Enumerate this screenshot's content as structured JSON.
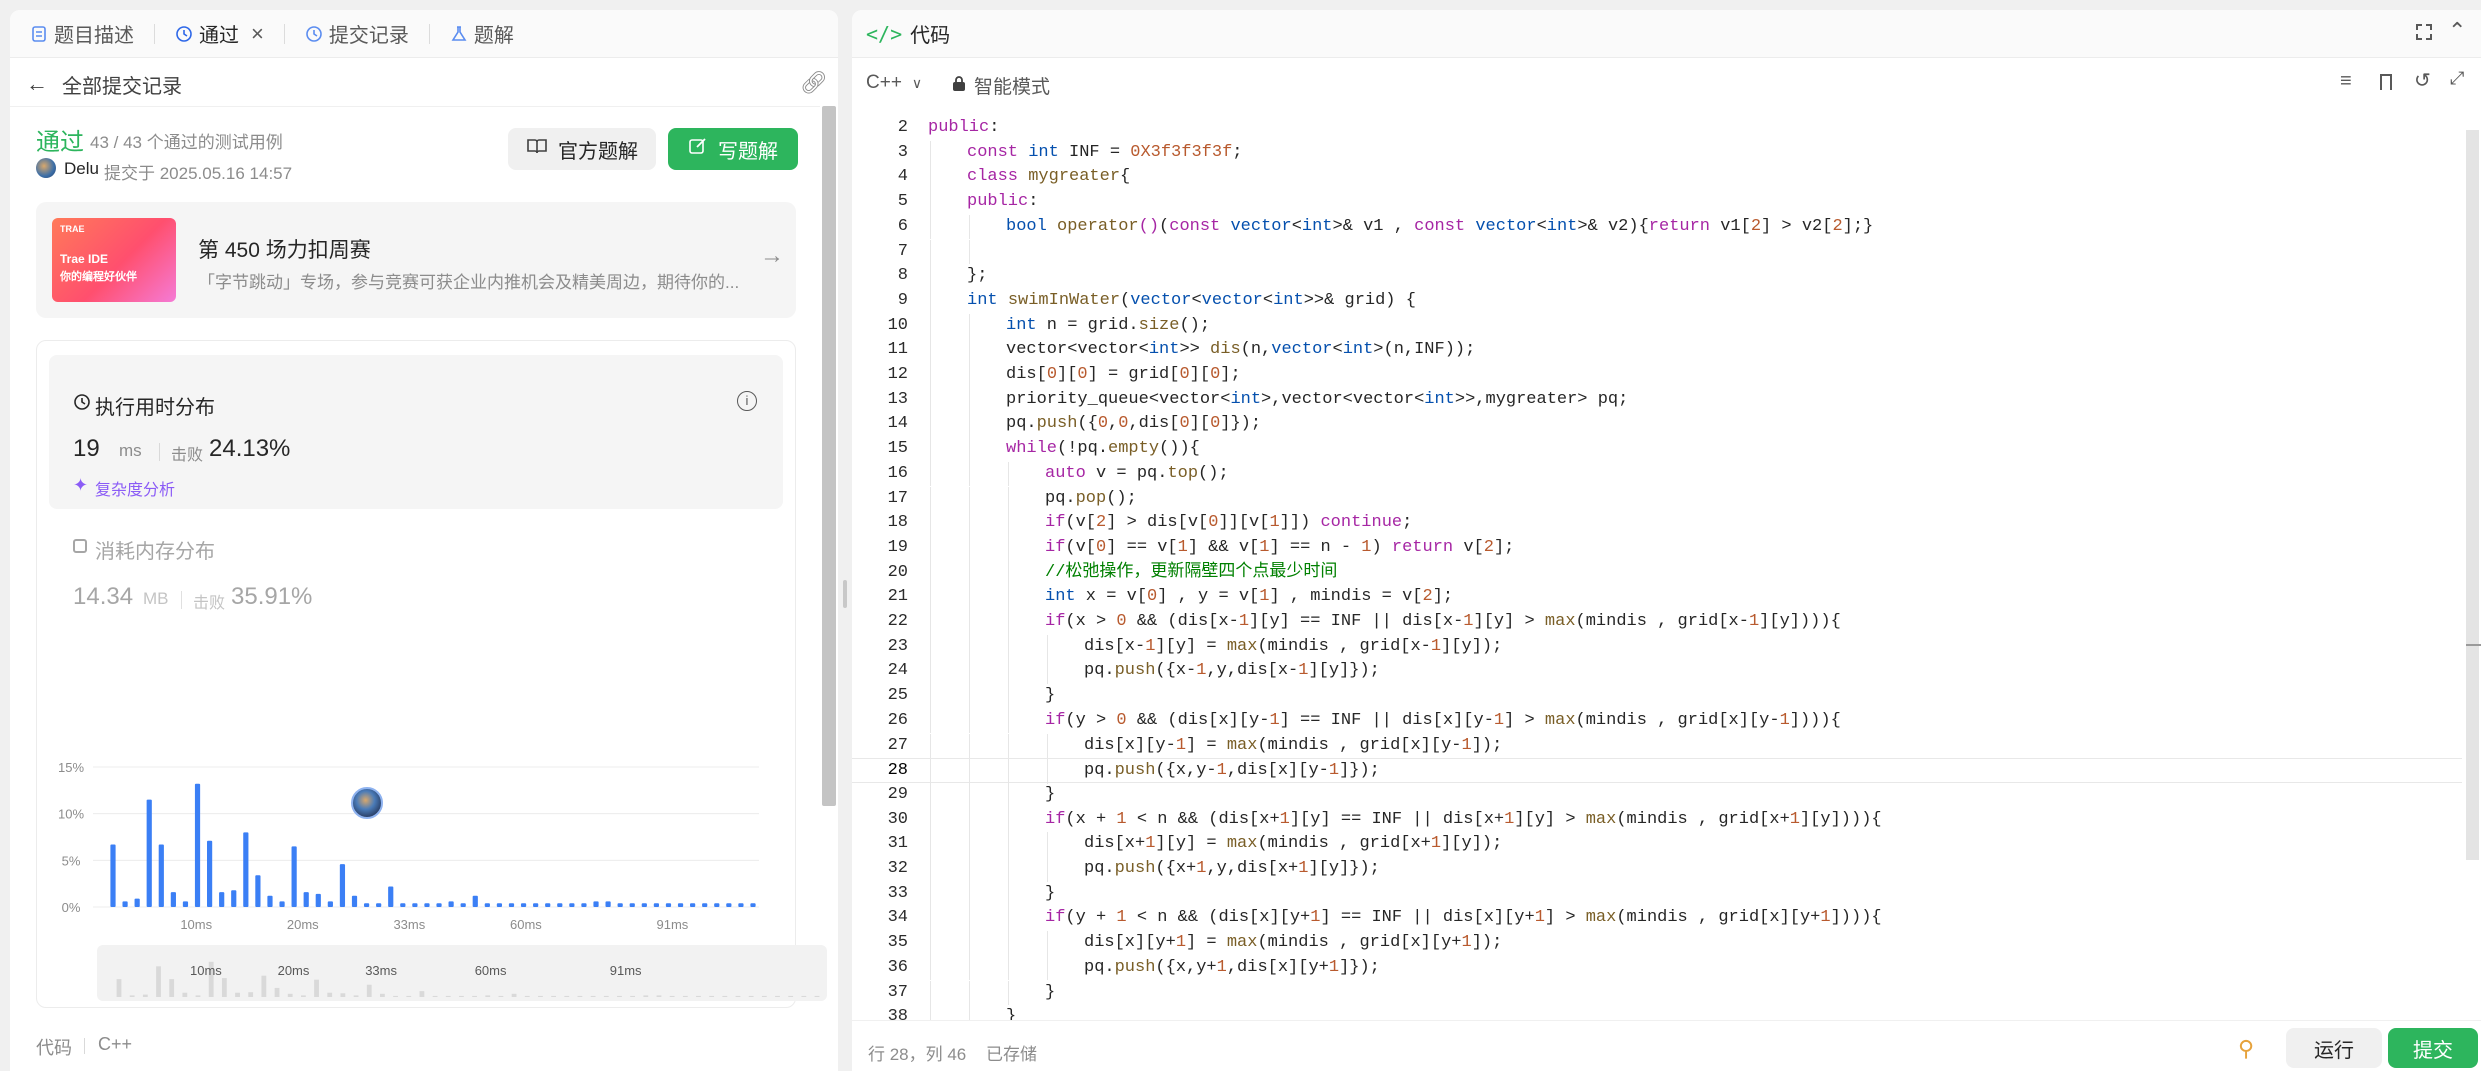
{
  "left_tabs": [
    {
      "label": "题目描述"
    },
    {
      "label": "通过"
    },
    {
      "label": "提交记录"
    },
    {
      "label": "题解"
    }
  ],
  "back_label": "全部提交记录",
  "result": {
    "status": "通过",
    "tests": "43 / 43 个通过的测试用例",
    "user": "Delu",
    "submitted": "提交于 2025.05.16 14:57"
  },
  "buttons": {
    "official": "官方题解",
    "write": "写题解"
  },
  "banner": {
    "thumb_tag": "TRAE",
    "thumb_line1": "Trae IDE",
    "thumb_line2": "你的编程好伙伴",
    "title": "第 450 场力扣周赛",
    "desc": "「字节跳动」专场，参与竞赛可获企业内推机会及精美周边，期待你的..."
  },
  "runtime": {
    "title": "执行用时分布",
    "value": "19",
    "unit": "ms",
    "beat_label": "击败",
    "beat": "24.13%",
    "analysis": "复杂度分析"
  },
  "memory": {
    "title": "消耗内存分布",
    "value": "14.34",
    "unit": "MB",
    "beat_label": "击败",
    "beat": "35.91%"
  },
  "chart_data": {
    "type": "bar",
    "y_ticks": [
      "15%",
      "10%",
      "5%",
      "0%"
    ],
    "x_ticks": [
      "10ms",
      "20ms",
      "33ms",
      "60ms",
      "91ms"
    ],
    "ylim": [
      0,
      15
    ],
    "values": [
      6.7,
      0.6,
      0.9,
      11.5,
      6.7,
      1.6,
      0.6,
      13.2,
      7.1,
      1.6,
      1.8,
      8.0,
      3.4,
      1.2,
      0.6,
      6.5,
      1.6,
      1.4,
      0.6,
      4.6,
      1.2,
      0.4,
      0.4,
      2.2,
      0.4,
      0.4,
      0.4,
      0.4,
      0.6,
      0.4,
      1.2,
      0.4,
      0.4,
      0.4,
      0.4,
      0.4,
      0.4,
      0.4,
      0.4,
      0.4,
      0.6,
      0.6,
      0.4,
      0.4,
      0.4,
      0.4,
      0.4,
      0.4,
      0.4,
      0.4,
      0.4,
      0.4,
      0.4,
      0.4
    ],
    "mini_x_ticks": [
      "10ms",
      "20ms",
      "33ms",
      "60ms",
      "91ms"
    ]
  },
  "code_footer": {
    "label": "代码",
    "lang": "C++"
  },
  "editor": {
    "title": "代码",
    "lang": "C++",
    "mode": "智能模式",
    "status": "行 28，列 46",
    "saved": "已存储",
    "run": "运行",
    "submit": "提交"
  },
  "code_lines": [
    {
      "n": "2",
      "i": 0,
      "t": [
        [
          "kw",
          "public"
        ],
        [
          "pl",
          ":"
        ]
      ]
    },
    {
      "n": "3",
      "i": 1,
      "t": [
        [
          "kw",
          "const "
        ],
        [
          "ty",
          "int"
        ],
        [
          "pl",
          " INF = "
        ],
        [
          "nm",
          "0X3f3f3f3f"
        ],
        [
          "pl",
          ";"
        ]
      ]
    },
    {
      "n": "4",
      "i": 1,
      "t": [
        [
          "kw",
          "class "
        ],
        [
          "fn",
          "mygreater"
        ],
        [
          "pl",
          "{"
        ]
      ]
    },
    {
      "n": "5",
      "i": 1,
      "t": [
        [
          "kw",
          "public"
        ],
        [
          "pl",
          ":"
        ]
      ]
    },
    {
      "n": "6",
      "i": 2,
      "t": [
        [
          "ty",
          "bool "
        ],
        [
          "fn",
          "operator"
        ],
        [
          "kw",
          "()"
        ],
        [
          "pl",
          "("
        ],
        [
          "kw",
          "const "
        ],
        [
          "ty",
          "vector"
        ],
        [
          "pl",
          "<"
        ],
        [
          "ty",
          "int"
        ],
        [
          "pl",
          ">& v1 , "
        ],
        [
          "kw",
          "const "
        ],
        [
          "ty",
          "vector"
        ],
        [
          "pl",
          "<"
        ],
        [
          "ty",
          "int"
        ],
        [
          "pl",
          ">& v2){"
        ],
        [
          "kw",
          "return "
        ],
        [
          "pl",
          "v1["
        ],
        [
          "nm",
          "2"
        ],
        [
          "pl",
          "] > v2["
        ],
        [
          "nm",
          "2"
        ],
        [
          "pl",
          "];}"
        ]
      ]
    },
    {
      "n": "7",
      "i": 2,
      "t": []
    },
    {
      "n": "8",
      "i": 1,
      "t": [
        [
          "pl",
          "};"
        ]
      ]
    },
    {
      "n": "9",
      "i": 1,
      "t": [
        [
          "ty",
          "int "
        ],
        [
          "fn",
          "swimInWater"
        ],
        [
          "pl",
          "("
        ],
        [
          "ty",
          "vector"
        ],
        [
          "pl",
          "<"
        ],
        [
          "ty",
          "vector"
        ],
        [
          "pl",
          "<"
        ],
        [
          "ty",
          "int"
        ],
        [
          "pl",
          ">>& grid) {"
        ]
      ]
    },
    {
      "n": "10",
      "i": 2,
      "t": [
        [
          "ty",
          "int"
        ],
        [
          "pl",
          " n = grid."
        ],
        [
          "fn",
          "size"
        ],
        [
          "pl",
          "();"
        ]
      ]
    },
    {
      "n": "11",
      "i": 2,
      "t": [
        [
          "pl",
          "vector<vector<"
        ],
        [
          "ty",
          "int"
        ],
        [
          "pl",
          ">> "
        ],
        [
          "fn",
          "dis"
        ],
        [
          "pl",
          "(n,"
        ],
        [
          "ty",
          "vector"
        ],
        [
          "pl",
          "<"
        ],
        [
          "ty",
          "int"
        ],
        [
          "pl",
          ">(n,INF));"
        ]
      ]
    },
    {
      "n": "12",
      "i": 2,
      "t": [
        [
          "pl",
          "dis["
        ],
        [
          "nm",
          "0"
        ],
        [
          "pl",
          "]["
        ],
        [
          "nm",
          "0"
        ],
        [
          "pl",
          "] = grid["
        ],
        [
          "nm",
          "0"
        ],
        [
          "pl",
          "]["
        ],
        [
          "nm",
          "0"
        ],
        [
          "pl",
          "];"
        ]
      ]
    },
    {
      "n": "13",
      "i": 2,
      "t": [
        [
          "pl",
          "priority_queue<vector<"
        ],
        [
          "ty",
          "int"
        ],
        [
          "pl",
          ">,vector<vector<"
        ],
        [
          "ty",
          "int"
        ],
        [
          "pl",
          ">>,mygreater> pq;"
        ]
      ]
    },
    {
      "n": "14",
      "i": 2,
      "t": [
        [
          "pl",
          "pq."
        ],
        [
          "fn",
          "push"
        ],
        [
          "pl",
          "({"
        ],
        [
          "nm",
          "0"
        ],
        [
          "pl",
          ","
        ],
        [
          "nm",
          "0"
        ],
        [
          "pl",
          ",dis["
        ],
        [
          "nm",
          "0"
        ],
        [
          "pl",
          "]["
        ],
        [
          "nm",
          "0"
        ],
        [
          "pl",
          "]});"
        ]
      ]
    },
    {
      "n": "15",
      "i": 2,
      "t": [
        [
          "kw",
          "while"
        ],
        [
          "pl",
          "(!pq."
        ],
        [
          "fn",
          "empty"
        ],
        [
          "pl",
          "()){"
        ]
      ]
    },
    {
      "n": "16",
      "i": 3,
      "t": [
        [
          "kw",
          "auto"
        ],
        [
          "pl",
          " v = pq."
        ],
        [
          "fn",
          "top"
        ],
        [
          "pl",
          "();"
        ]
      ]
    },
    {
      "n": "17",
      "i": 3,
      "t": [
        [
          "pl",
          "pq."
        ],
        [
          "fn",
          "pop"
        ],
        [
          "pl",
          "();"
        ]
      ]
    },
    {
      "n": "18",
      "i": 3,
      "t": [
        [
          "kw",
          "if"
        ],
        [
          "pl",
          "(v["
        ],
        [
          "nm",
          "2"
        ],
        [
          "pl",
          "] > dis[v["
        ],
        [
          "nm",
          "0"
        ],
        [
          "pl",
          "]][v["
        ],
        [
          "nm",
          "1"
        ],
        [
          "pl",
          "]]) "
        ],
        [
          "kw",
          "continue"
        ],
        [
          "pl",
          ";"
        ]
      ]
    },
    {
      "n": "19",
      "i": 3,
      "t": [
        [
          "kw",
          "if"
        ],
        [
          "pl",
          "(v["
        ],
        [
          "nm",
          "0"
        ],
        [
          "pl",
          "] == v["
        ],
        [
          "nm",
          "1"
        ],
        [
          "pl",
          "] && v["
        ],
        [
          "nm",
          "1"
        ],
        [
          "pl",
          "] == n - "
        ],
        [
          "nm",
          "1"
        ],
        [
          "pl",
          ") "
        ],
        [
          "kw",
          "return "
        ],
        [
          "pl",
          "v["
        ],
        [
          "nm",
          "2"
        ],
        [
          "pl",
          "];"
        ]
      ]
    },
    {
      "n": "20",
      "i": 3,
      "t": [
        [
          "cm",
          "//松弛操作，更新隔壁四个点最少时间"
        ]
      ]
    },
    {
      "n": "21",
      "i": 3,
      "t": [
        [
          "ty",
          "int"
        ],
        [
          "pl",
          " x = v["
        ],
        [
          "nm",
          "0"
        ],
        [
          "pl",
          "] , y = v["
        ],
        [
          "nm",
          "1"
        ],
        [
          "pl",
          "] , mindis = v["
        ],
        [
          "nm",
          "2"
        ],
        [
          "pl",
          "];"
        ]
      ]
    },
    {
      "n": "22",
      "i": 3,
      "t": [
        [
          "kw",
          "if"
        ],
        [
          "pl",
          "(x > "
        ],
        [
          "nm",
          "0"
        ],
        [
          "pl",
          " && (dis[x-"
        ],
        [
          "nm",
          "1"
        ],
        [
          "pl",
          "][y] == INF || dis[x-"
        ],
        [
          "nm",
          "1"
        ],
        [
          "pl",
          "][y] > "
        ],
        [
          "fn",
          "max"
        ],
        [
          "pl",
          "(mindis , grid[x-"
        ],
        [
          "nm",
          "1"
        ],
        [
          "pl",
          "][y]))){"
        ]
      ]
    },
    {
      "n": "23",
      "i": 4,
      "t": [
        [
          "pl",
          "dis[x-"
        ],
        [
          "nm",
          "1"
        ],
        [
          "pl",
          "][y] = "
        ],
        [
          "fn",
          "max"
        ],
        [
          "pl",
          "(mindis , grid[x-"
        ],
        [
          "nm",
          "1"
        ],
        [
          "pl",
          "][y]);"
        ]
      ]
    },
    {
      "n": "24",
      "i": 4,
      "t": [
        [
          "pl",
          "pq."
        ],
        [
          "fn",
          "push"
        ],
        [
          "pl",
          "({x-"
        ],
        [
          "nm",
          "1"
        ],
        [
          "pl",
          ",y,dis[x-"
        ],
        [
          "nm",
          "1"
        ],
        [
          "pl",
          "][y]});"
        ]
      ]
    },
    {
      "n": "25",
      "i": 3,
      "t": [
        [
          "pl",
          "}"
        ]
      ]
    },
    {
      "n": "26",
      "i": 3,
      "t": [
        [
          "kw",
          "if"
        ],
        [
          "pl",
          "(y > "
        ],
        [
          "nm",
          "0"
        ],
        [
          "pl",
          " && (dis[x][y-"
        ],
        [
          "nm",
          "1"
        ],
        [
          "pl",
          "] == INF || dis[x][y-"
        ],
        [
          "nm",
          "1"
        ],
        [
          "pl",
          "] > "
        ],
        [
          "fn",
          "max"
        ],
        [
          "pl",
          "(mindis , grid[x][y-"
        ],
        [
          "nm",
          "1"
        ],
        [
          "pl",
          "]))){"
        ]
      ]
    },
    {
      "n": "27",
      "i": 4,
      "t": [
        [
          "pl",
          "dis[x][y-"
        ],
        [
          "nm",
          "1"
        ],
        [
          "pl",
          "] = "
        ],
        [
          "fn",
          "max"
        ],
        [
          "pl",
          "(mindis , grid[x][y-"
        ],
        [
          "nm",
          "1"
        ],
        [
          "pl",
          "]);"
        ]
      ]
    },
    {
      "n": "28",
      "i": 4,
      "t": [
        [
          "pl",
          "pq."
        ],
        [
          "fn",
          "push"
        ],
        [
          "pl",
          "({x,y-"
        ],
        [
          "nm",
          "1"
        ],
        [
          "pl",
          ",dis[x][y-"
        ],
        [
          "nm",
          "1"
        ],
        [
          "pl",
          "]});"
        ]
      ]
    },
    {
      "n": "29",
      "i": 3,
      "t": [
        [
          "pl",
          "}"
        ]
      ]
    },
    {
      "n": "30",
      "i": 3,
      "t": [
        [
          "kw",
          "if"
        ],
        [
          "pl",
          "(x + "
        ],
        [
          "nm",
          "1"
        ],
        [
          "pl",
          " < n && (dis[x+"
        ],
        [
          "nm",
          "1"
        ],
        [
          "pl",
          "][y] == INF || dis[x+"
        ],
        [
          "nm",
          "1"
        ],
        [
          "pl",
          "][y] > "
        ],
        [
          "fn",
          "max"
        ],
        [
          "pl",
          "(mindis , grid[x+"
        ],
        [
          "nm",
          "1"
        ],
        [
          "pl",
          "][y]))){"
        ]
      ]
    },
    {
      "n": "31",
      "i": 4,
      "t": [
        [
          "pl",
          "dis[x+"
        ],
        [
          "nm",
          "1"
        ],
        [
          "pl",
          "][y] = "
        ],
        [
          "fn",
          "max"
        ],
        [
          "pl",
          "(mindis , grid[x+"
        ],
        [
          "nm",
          "1"
        ],
        [
          "pl",
          "][y]);"
        ]
      ]
    },
    {
      "n": "32",
      "i": 4,
      "t": [
        [
          "pl",
          "pq."
        ],
        [
          "fn",
          "push"
        ],
        [
          "pl",
          "({x+"
        ],
        [
          "nm",
          "1"
        ],
        [
          "pl",
          ",y,dis[x+"
        ],
        [
          "nm",
          "1"
        ],
        [
          "pl",
          "][y]});"
        ]
      ]
    },
    {
      "n": "33",
      "i": 3,
      "t": [
        [
          "pl",
          "}"
        ]
      ]
    },
    {
      "n": "34",
      "i": 3,
      "t": [
        [
          "kw",
          "if"
        ],
        [
          "pl",
          "(y + "
        ],
        [
          "nm",
          "1"
        ],
        [
          "pl",
          " < n && (dis[x][y+"
        ],
        [
          "nm",
          "1"
        ],
        [
          "pl",
          "] == INF || dis[x][y+"
        ],
        [
          "nm",
          "1"
        ],
        [
          "pl",
          "] > "
        ],
        [
          "fn",
          "max"
        ],
        [
          "pl",
          "(mindis , grid[x][y+"
        ],
        [
          "nm",
          "1"
        ],
        [
          "pl",
          "]))){"
        ]
      ]
    },
    {
      "n": "35",
      "i": 4,
      "t": [
        [
          "pl",
          "dis[x][y+"
        ],
        [
          "nm",
          "1"
        ],
        [
          "pl",
          "] = "
        ],
        [
          "fn",
          "max"
        ],
        [
          "pl",
          "(mindis , grid[x][y+"
        ],
        [
          "nm",
          "1"
        ],
        [
          "pl",
          "]);"
        ]
      ]
    },
    {
      "n": "36",
      "i": 4,
      "t": [
        [
          "pl",
          "pq."
        ],
        [
          "fn",
          "push"
        ],
        [
          "pl",
          "({x,y+"
        ],
        [
          "nm",
          "1"
        ],
        [
          "pl",
          ",dis[x][y+"
        ],
        [
          "nm",
          "1"
        ],
        [
          "pl",
          "]});"
        ]
      ]
    },
    {
      "n": "37",
      "i": 3,
      "t": [
        [
          "pl",
          "}"
        ]
      ]
    },
    {
      "n": "38",
      "i": 2,
      "t": [
        [
          "pl",
          "}"
        ]
      ]
    }
  ],
  "current_line": "28"
}
